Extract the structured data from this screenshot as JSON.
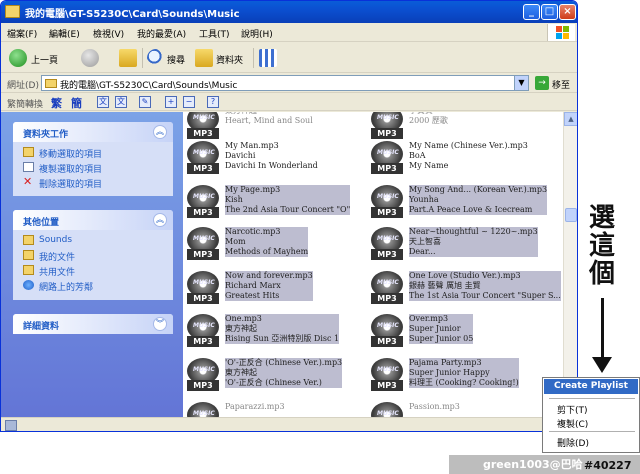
{
  "window": {
    "title": "我的電腦\\GT-S5230C\\Card\\Sounds\\Music",
    "min_icon": "minimize-icon",
    "max_icon": "maximize-icon",
    "close_icon": "close-icon",
    "min_glyph": "_",
    "max_glyph": "□",
    "close_glyph": "×"
  },
  "menubar": [
    "檔案(F)",
    "編輯(E)",
    "檢視(V)",
    "我的最愛(A)",
    "工具(T)",
    "說明(H)"
  ],
  "toolbar": {
    "back_label": "上一頁",
    "search_label": "搜尋",
    "folders_label": "資料夾"
  },
  "address": {
    "label": "網址(D)",
    "value": "我的電腦\\GT-S5230C\\Card\\Sounds\\Music",
    "go_label": "移至",
    "go_glyph": "→"
  },
  "conv": {
    "label": "繁簡轉換",
    "trad": "繁",
    "simp": "簡"
  },
  "left": {
    "folder_tasks": {
      "title": "資料夾工作",
      "items": [
        "移動選取的項目",
        "複製選取的項目",
        "刪除選取的項目"
      ]
    },
    "other_places": {
      "title": "其他位置",
      "items": [
        "Sounds",
        "我的文件",
        "共用文件",
        "網路上的芳鄰"
      ]
    },
    "details": {
      "title": "詳細資料"
    },
    "collapse_glyph": "︽",
    "expand_glyph": "︾"
  },
  "files": [
    {
      "l1": "東方神起",
      "l2": "Heart, Mind and Soul",
      "l3": "",
      "selected": false,
      "partial": true
    },
    {
      "l1": "李貞賢",
      "l2": "2000 歷歌",
      "l3": "",
      "selected": false,
      "partial": true
    },
    {
      "l1": "My Man.mp3",
      "l2": "Davichi",
      "l3": "Davichi In Wonderland",
      "selected": false
    },
    {
      "l1": "My Name (Chinese Ver.).mp3",
      "l2": "BoA",
      "l3": "My Name",
      "selected": false
    },
    {
      "l1": "My Page.mp3",
      "l2": "Kish",
      "l3": "The 2nd Asia Tour Concert \"O\"",
      "selected": true
    },
    {
      "l1": "My Song And... (Korean Ver.).mp3",
      "l2": "Younha",
      "l3": "Part.A Peace Love & Icecream",
      "selected": true
    },
    {
      "l1": "Narcotic.mp3",
      "l2": "Mom",
      "l3": "Methods of Mayhem",
      "selected": true
    },
    {
      "l1": "Near~thoughtful ~ 1220~.mp3",
      "l2": "天上智喜",
      "l3": "Dear...",
      "selected": true
    },
    {
      "l1": "Now and forever.mp3",
      "l2": "Richard Marx",
      "l3": "Greatest Hits",
      "selected": true
    },
    {
      "l1": "One Love (Studio Ver.).mp3",
      "l2": "銀赫 藝聲 厲旭 圭賢",
      "l3": "The 1st Asia Tour Concert \"Super S...",
      "selected": true
    },
    {
      "l1": "One.mp3",
      "l2": "東方神起",
      "l3": "Rising Sun 亞洲特別版 Disc 1",
      "selected": true
    },
    {
      "l1": "Over.mp3",
      "l2": "Super Junior",
      "l3": "Super Junior 05",
      "selected": true
    },
    {
      "l1": "'O'-正反合 (Chinese Ver.).mp3",
      "l2": "東方神起",
      "l3": "'O'-正反合 (Chinese Ver.)",
      "selected": true
    },
    {
      "l1": "Pajama Party.mp3",
      "l2": "Super Junior Happy",
      "l3": "料理王 (Cooking? Cooking!)",
      "selected": true
    },
    {
      "l1": "Paparazzi.mp3",
      "l2": "",
      "l3": "",
      "selected": false,
      "partial": true
    },
    {
      "l1": "Passion.mp3",
      "l2": "",
      "l3": "",
      "selected": false,
      "partial": true
    }
  ],
  "mp3": {
    "tag": "MP3",
    "disc_word": "MUSIC"
  },
  "scroll": {
    "up_glyph": "▲"
  },
  "context_menu": {
    "create": "Create Playlist",
    "cut": "剪下(T)",
    "copy": "複製(C)",
    "delete": "刪除(D)"
  },
  "annotation": {
    "text": "選這個"
  },
  "watermark": {
    "text": "green1003@巴哈",
    "num": "#40227"
  }
}
